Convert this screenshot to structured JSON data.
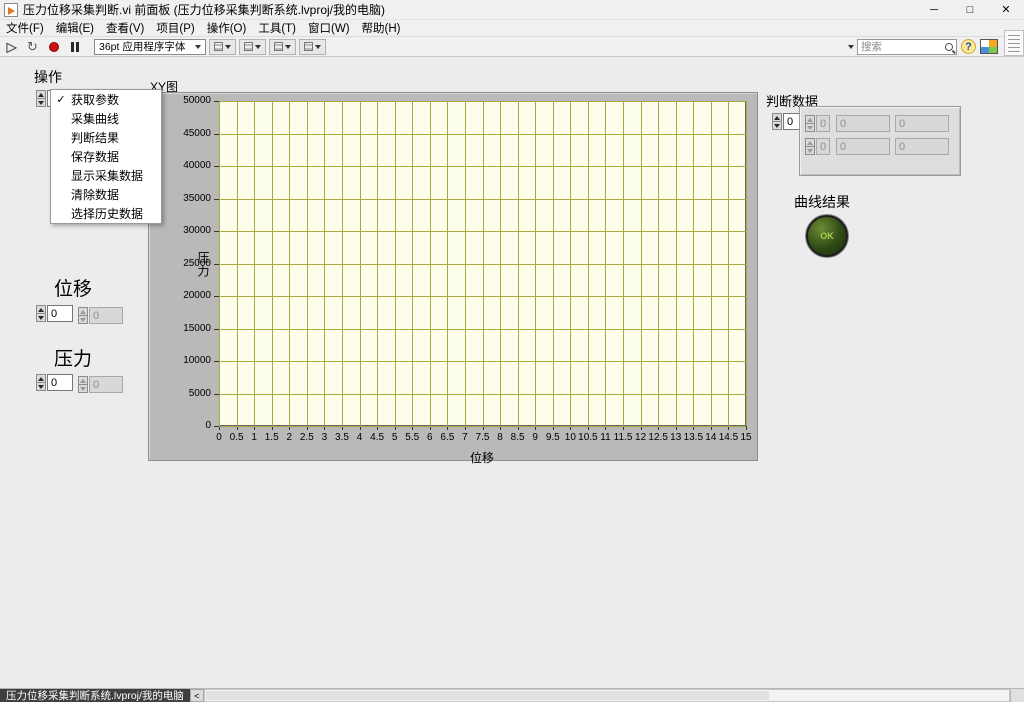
{
  "window": {
    "title": "压力位移采集判断.vi 前面板 (压力位移采集判断系统.lvproj/我的电脑)",
    "controls": {
      "minimize": "─",
      "maximize": "□",
      "close": "✕"
    }
  },
  "menu_bar": {
    "items": [
      "文件(F)",
      "编辑(E)",
      "查看(V)",
      "项目(P)",
      "操作(O)",
      "工具(T)",
      "窗口(W)",
      "帮助(H)"
    ]
  },
  "toolbar": {
    "font_selector": "36pt 应用程序字体",
    "search": {
      "placeholder": "搜索"
    }
  },
  "icons": {
    "run": "▶",
    "run_continuous": "↻",
    "abort": "abort-red-dot",
    "pause": "pause-bars",
    "search": "magnifier",
    "help": "?",
    "check": "✓",
    "scroll_left": "<"
  },
  "panel": {
    "operation": {
      "label": "操作",
      "menu": {
        "items": [
          {
            "label": "获取参数",
            "checked": true
          },
          {
            "label": "采集曲线",
            "checked": false
          },
          {
            "label": "判断结果",
            "checked": false
          },
          {
            "label": "保存数据",
            "checked": false
          },
          {
            "label": "显示采集数据",
            "checked": false
          },
          {
            "label": "清除数据",
            "checked": false
          },
          {
            "label": "选择历史数据",
            "checked": false
          }
        ]
      }
    },
    "displacement": {
      "label": "位移",
      "control_value": "0",
      "indicator_value": "0"
    },
    "pressure": {
      "label": "压力",
      "control_value": "0",
      "indicator_value": "0"
    },
    "judge": {
      "label": "判断数据",
      "index_control_value": "0",
      "array": {
        "index_values": [
          "0",
          "0"
        ],
        "rows": [
          [
            "0",
            "0"
          ],
          [
            "0",
            "0"
          ]
        ]
      }
    },
    "curve_result": {
      "label": "曲线结果",
      "led_text": "OK"
    }
  },
  "chart_data": {
    "type": "line",
    "title": "XY图",
    "xlabel": "位移",
    "ylabel": "压力",
    "xlim": [
      0,
      15
    ],
    "ylim": [
      0,
      50000
    ],
    "grid": true,
    "plot_bg": "#fdfdec",
    "grid_color": "#a9a93d",
    "x_tick_labels": [
      "0",
      "0.5",
      "1",
      "1.5",
      "2",
      "2.5",
      "3",
      "3.5",
      "4",
      "4.5",
      "5",
      "5.5",
      "6",
      "6.5",
      "7",
      "7.5",
      "8",
      "8.5",
      "9",
      "9.5",
      "10",
      "10.5",
      "11",
      "11.5",
      "12",
      "12.5",
      "13",
      "13.5",
      "14",
      "14.5",
      "15"
    ],
    "y_tick_labels": [
      "50000",
      "45000",
      "40000",
      "35000",
      "30000",
      "25000",
      "20000",
      "15000",
      "10000",
      "5000",
      "0"
    ],
    "series": []
  },
  "status_bar": {
    "project_label": "压力位移采集判断系统.lvproj/我的电脑"
  }
}
